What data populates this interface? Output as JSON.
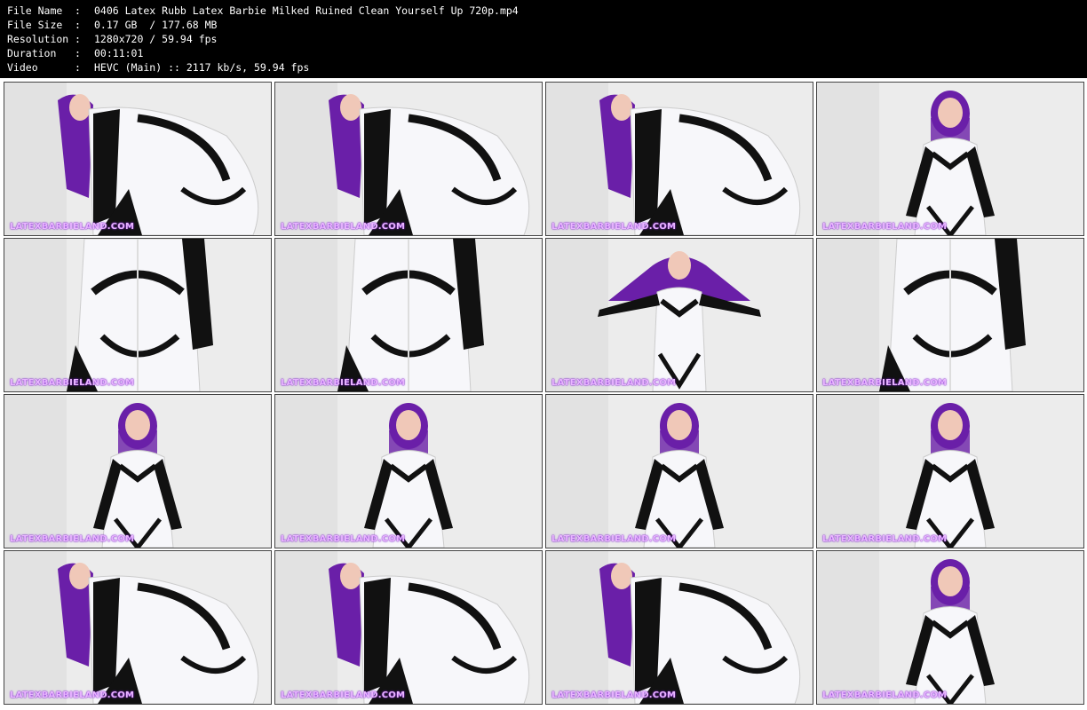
{
  "info": [
    {
      "key": "File Name",
      "value": "0406 Latex Rubb Latex Barbie Milked Ruined Clean Yourself Up 720p.mp4"
    },
    {
      "key": "File Size",
      "value": "0.17 GB  / 177.68 MB"
    },
    {
      "key": "Resolution",
      "value": "1280x720 / 59.94 fps"
    },
    {
      "key": "Duration",
      "value": "00:11:01"
    },
    {
      "key": "Video",
      "value": "HEVC (Main) :: 2117 kb/s, 59.94 fps"
    }
  ],
  "separator": ":",
  "watermark": "LATEXBARBIELAND.COM",
  "thumbnails": [
    {
      "pose": "bent-over"
    },
    {
      "pose": "bent-over"
    },
    {
      "pose": "bent-over"
    },
    {
      "pose": "standing"
    },
    {
      "pose": "rear"
    },
    {
      "pose": "rear"
    },
    {
      "pose": "arms-out"
    },
    {
      "pose": "rear"
    },
    {
      "pose": "standing"
    },
    {
      "pose": "standing"
    },
    {
      "pose": "standing"
    },
    {
      "pose": "standing"
    },
    {
      "pose": "bent-over"
    },
    {
      "pose": "bent-over"
    },
    {
      "pose": "bent-over"
    },
    {
      "pose": "standing"
    }
  ],
  "colors": {
    "hair": "#6a1fa8",
    "latex_white": "#f7f7fa",
    "latex_black": "#111111",
    "wall": "#ececec",
    "watermark": "#e9b6ff"
  }
}
